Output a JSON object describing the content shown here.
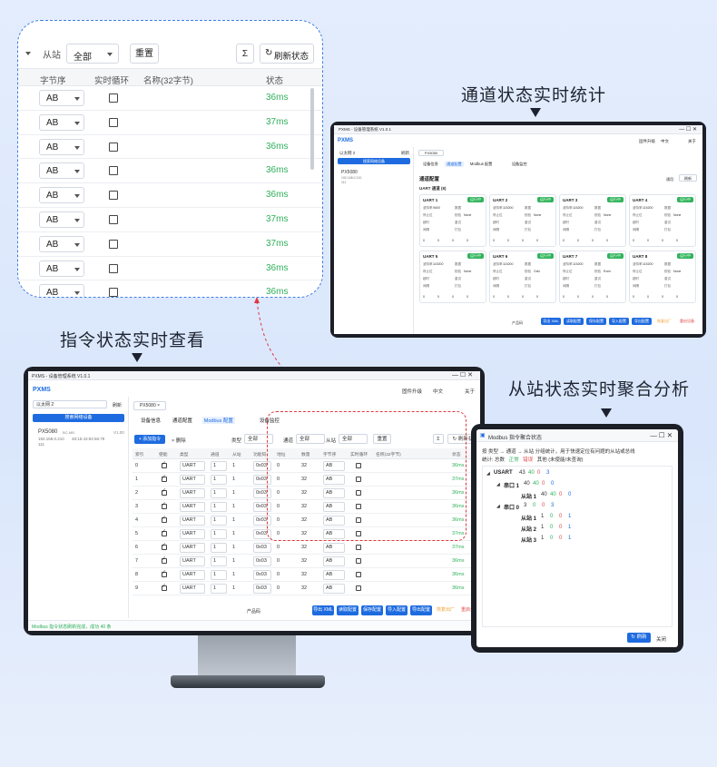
{
  "captions": {
    "channel": "通道状态实时统计",
    "command": "指令状态实时查看",
    "slave": "从站状态实时聚合分析"
  },
  "colors": {
    "accent": "#1e6be0",
    "ok": "#2fb05b",
    "error": "#e04b4b",
    "warn": "#f0a030",
    "zoom_border": "#3f7fe2"
  },
  "zoom": {
    "slave_label": "从站",
    "slave_value": "全部",
    "reset_label": "重置",
    "sigma": "Σ",
    "refresh_label": "刷新状态",
    "headers": [
      "字节序",
      "实时循环",
      "名称(32字节)",
      "状态"
    ],
    "rows": [
      {
        "order": "AB",
        "status": "36ms"
      },
      {
        "order": "AB",
        "status": "37ms"
      },
      {
        "order": "AB",
        "status": "36ms"
      },
      {
        "order": "AB",
        "status": "36ms"
      },
      {
        "order": "AB",
        "status": "36ms"
      },
      {
        "order": "AB",
        "status": "37ms"
      },
      {
        "order": "AB",
        "status": "37ms"
      },
      {
        "order": "AB",
        "status": "36ms"
      },
      {
        "order": "AB",
        "status": "36ms"
      }
    ]
  },
  "app": {
    "window_title": "PXMS - 设备管理系统 V1.0.1",
    "brand": "PXMS",
    "header_links": [
      "固件升级",
      "中文",
      "关于"
    ],
    "network": "以太网 2",
    "refresh": "刷新",
    "search_device": "搜索网络设备",
    "device": {
      "name": "PX5080",
      "tag": "BC-MB",
      "version": "V1.00",
      "ip": "192.168.0.210",
      "mac": "48:15:43:84:56:79",
      "extra": "111"
    },
    "tab_device": "PX5080",
    "subtabs": [
      "设备信息",
      "通道配置",
      "Modbus 配置",
      "设备监控"
    ],
    "footer": {
      "product": "产品码",
      "buttons": [
        "导出 XML",
        "读取配置",
        "保存配置",
        "导入配置",
        "导出配置",
        "恢复出厂",
        "重启设备"
      ]
    }
  },
  "channel_panel": {
    "title": "通道配置",
    "subtitle": "UART 通道 (8)",
    "generic": "通用",
    "refresh": "刷新",
    "run_tag": "运行中",
    "uarts": [
      {
        "name": "UART 1",
        "baud": "9600",
        "parity": "None",
        "stat": [
          "0",
          "0",
          "0",
          "0"
        ]
      },
      {
        "name": "UART 2",
        "baud": "115200",
        "parity": "None",
        "stat": [
          "0",
          "0",
          "0",
          "0"
        ]
      },
      {
        "name": "UART 3",
        "baud": "115200",
        "parity": "None",
        "stat": [
          "0",
          "0",
          "0",
          "0"
        ]
      },
      {
        "name": "UART 4",
        "baud": "115200",
        "parity": "None",
        "stat": [
          "0",
          "0",
          "0",
          "0"
        ]
      },
      {
        "name": "UART 5",
        "baud": "115200",
        "parity": "None",
        "stat": [
          "0",
          "0",
          "0",
          "0"
        ]
      },
      {
        "name": "UART 6",
        "baud": "115200",
        "parity": "Odd",
        "stat": [
          "0",
          "0",
          "0",
          "0"
        ]
      },
      {
        "name": "UART 7",
        "baud": "115200",
        "parity": "Even",
        "stat": [
          "0",
          "0",
          "0",
          "0"
        ]
      },
      {
        "name": "UART 8",
        "baud": "115200",
        "parity": "None",
        "stat": [
          "0",
          "0",
          "0",
          "0"
        ]
      }
    ],
    "field_labels": [
      "波特率",
      "数据",
      "停止位",
      "校验",
      "超时",
      "重试",
      "间隔",
      "打包"
    ]
  },
  "command_panel": {
    "add": "+ 添加指令",
    "delete": "× 删除",
    "type_label": "类型",
    "type_value": "全部",
    "channel_label": "通道",
    "channel_value": "全部",
    "slave_label": "从站",
    "slave_value": "全部",
    "reset": "重置",
    "sigma": "Σ",
    "refresh": "刷新状",
    "headers": [
      "索引",
      "使能",
      "类型",
      "通道",
      "从站",
      "功能码",
      "地址",
      "数量",
      "字节序",
      "实时循环",
      "名称(32字节)",
      "状态"
    ],
    "rows": [
      {
        "idx": "0",
        "type": "UART",
        "ch": "1",
        "slave": "1",
        "fc": "0x03",
        "addr": "0",
        "qty": "32",
        "order": "AB",
        "status": "36ms"
      },
      {
        "idx": "1",
        "type": "UART",
        "ch": "1",
        "slave": "1",
        "fc": "0x03",
        "addr": "0",
        "qty": "32",
        "order": "AB",
        "status": "37ms"
      },
      {
        "idx": "2",
        "type": "UART",
        "ch": "1",
        "slave": "1",
        "fc": "0x03",
        "addr": "0",
        "qty": "32",
        "order": "AB",
        "status": "36ms"
      },
      {
        "idx": "3",
        "type": "UART",
        "ch": "1",
        "slave": "1",
        "fc": "0x03",
        "addr": "0",
        "qty": "32",
        "order": "AB",
        "status": "36ms"
      },
      {
        "idx": "4",
        "type": "UART",
        "ch": "1",
        "slave": "1",
        "fc": "0x03",
        "addr": "0",
        "qty": "32",
        "order": "AB",
        "status": "36ms"
      },
      {
        "idx": "5",
        "type": "UART",
        "ch": "1",
        "slave": "1",
        "fc": "0x03",
        "addr": "0",
        "qty": "32",
        "order": "AB",
        "status": "37ms"
      },
      {
        "idx": "6",
        "type": "UART",
        "ch": "1",
        "slave": "1",
        "fc": "0x03",
        "addr": "0",
        "qty": "32",
        "order": "AB",
        "status": "37ms"
      },
      {
        "idx": "7",
        "type": "UART",
        "ch": "1",
        "slave": "1",
        "fc": "0x03",
        "addr": "0",
        "qty": "32",
        "order": "AB",
        "status": "36ms"
      },
      {
        "idx": "8",
        "type": "UART",
        "ch": "1",
        "slave": "1",
        "fc": "0x03",
        "addr": "0",
        "qty": "32",
        "order": "AB",
        "status": "36ms"
      },
      {
        "idx": "9",
        "type": "UART",
        "ch": "1",
        "slave": "1",
        "fc": "0x03",
        "addr": "0",
        "qty": "32",
        "order": "AB",
        "status": "36ms"
      }
    ],
    "status_line": "Modbus 指令状态刷新完成，成功 40 条"
  },
  "slave_dialog": {
    "title": "Modbus 指令聚合状态",
    "desc": "按 类型 → 通道 → 从站 分组统计，用于快速定位有问题的从站或总线",
    "legend_prefix": "统计: 总数",
    "legend_ok": "正常",
    "legend_err": "错误",
    "legend_other": "其他 (未使能/未查询)",
    "tree": [
      {
        "label": "USART",
        "nums": [
          "43",
          "40",
          "0",
          "3"
        ],
        "level": 0
      },
      {
        "label": "串口 1",
        "nums": [
          "40",
          "40",
          "0",
          "0"
        ],
        "level": 1
      },
      {
        "label": "从站 1",
        "nums": [
          "40",
          "40",
          "0",
          "0"
        ],
        "level": 2
      },
      {
        "label": "串口 0",
        "nums": [
          "3",
          "0",
          "0",
          "3"
        ],
        "level": 1
      },
      {
        "label": "从站 1",
        "nums": [
          "1",
          "0",
          "0",
          "1"
        ],
        "level": 2
      },
      {
        "label": "从站 2",
        "nums": [
          "1",
          "0",
          "0",
          "1"
        ],
        "level": 2
      },
      {
        "label": "从站 3",
        "nums": [
          "1",
          "0",
          "0",
          "1"
        ],
        "level": 2
      }
    ],
    "refresh": "刷新",
    "close": "关闭"
  }
}
